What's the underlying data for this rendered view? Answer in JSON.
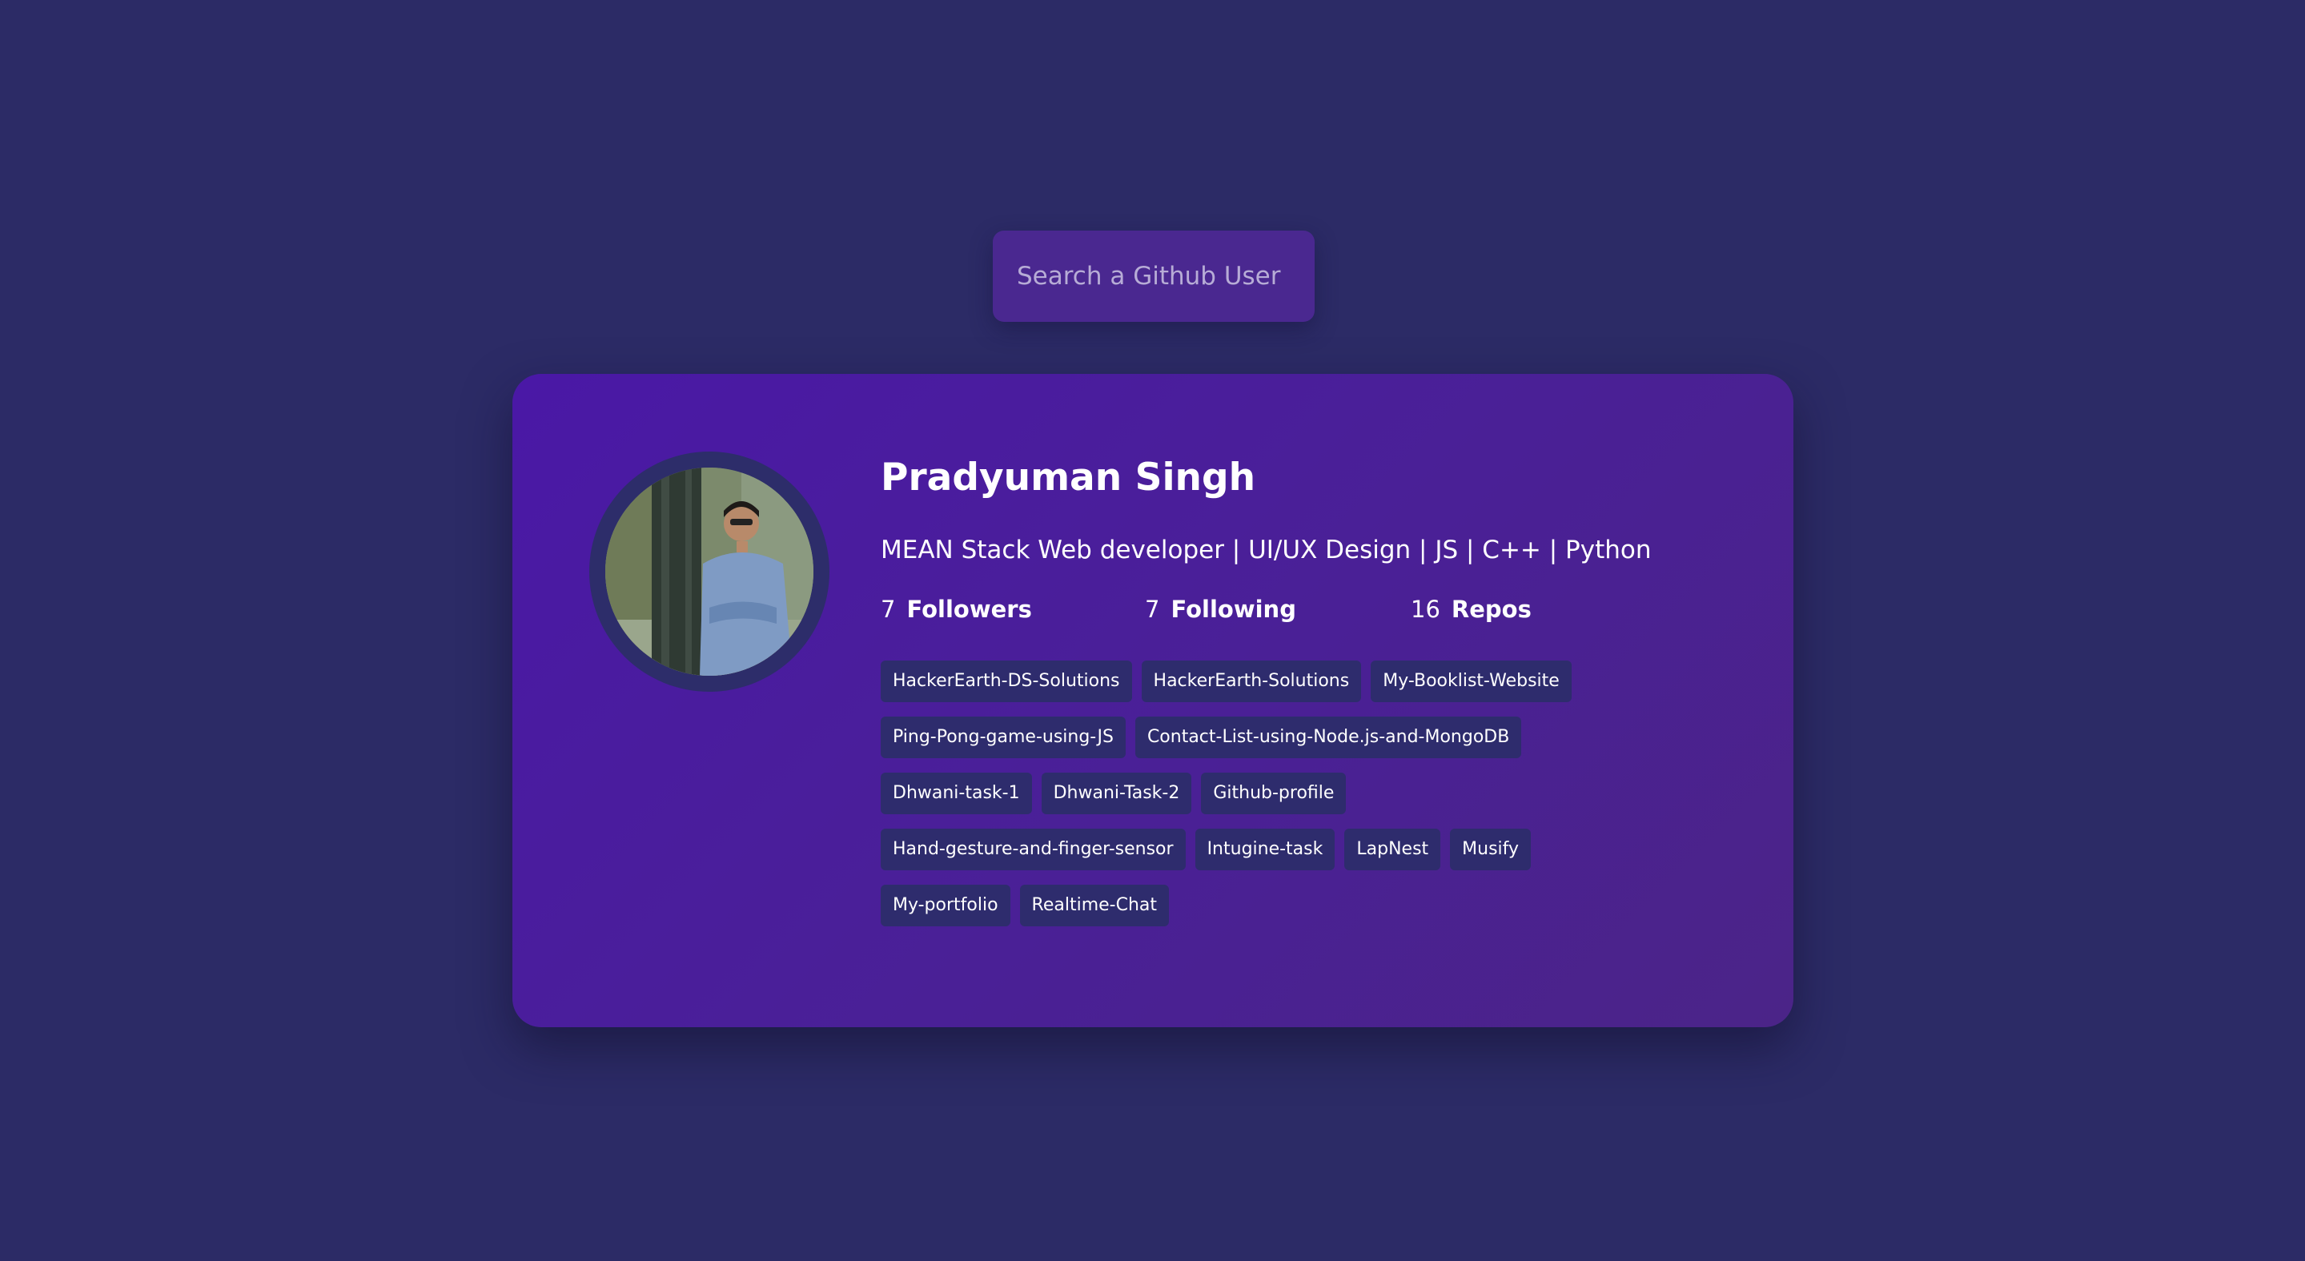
{
  "search": {
    "placeholder": "Search a Github User",
    "value": ""
  },
  "profile": {
    "name": "Pradyuman Singh",
    "bio": "MEAN Stack Web developer | UI/UX Design | JS | C++ | Python",
    "avatar": "profile-photo"
  },
  "stats": {
    "followers": {
      "count": "7",
      "label": "Followers"
    },
    "following": {
      "count": "7",
      "label": "Following"
    },
    "repos": {
      "count": "16",
      "label": "Repos"
    }
  },
  "repos": [
    "HackerEarth-DS-Solutions",
    "HackerEarth-Solutions",
    "My-Booklist-Website",
    "Ping-Pong-game-using-JS",
    "Contact-List-using-Node.js-and-MongoDB",
    "Dhwani-task-1",
    "Dhwani-Task-2",
    "Github-profile",
    "Hand-gesture-and-finger-sensor",
    "Intugine-task",
    "LapNest",
    "Musify",
    "My-portfolio",
    "Realtime-Chat"
  ],
  "colors": {
    "background": "#2c2b66",
    "card_start": "#4a18a6",
    "card_end": "#4b2488",
    "search_bg": "#4a2890",
    "repo_tag_bg": "#2e2c6d",
    "text": "#ffffff"
  }
}
